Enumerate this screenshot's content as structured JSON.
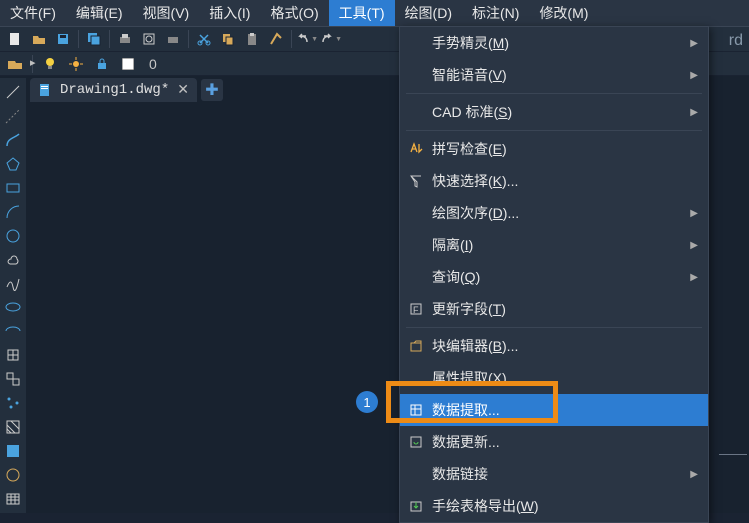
{
  "menubar": [
    {
      "label": "文件(F)"
    },
    {
      "label": "编辑(E)"
    },
    {
      "label": "视图(V)"
    },
    {
      "label": "插入(I)"
    },
    {
      "label": "格式(O)"
    },
    {
      "label": "工具(T)",
      "active": true
    },
    {
      "label": "绘图(D)"
    },
    {
      "label": "标注(N)"
    },
    {
      "label": "修改(M)"
    }
  ],
  "toolbar2": {
    "layer_value": "0"
  },
  "tab": {
    "title": "Drawing1.dwg*"
  },
  "right_fragment": "rd",
  "callout": {
    "num": "1"
  },
  "dropdown": {
    "items": [
      {
        "label": "手势精灵(",
        "hot": "M",
        "tail": ")",
        "submenu": true
      },
      {
        "label": "智能语音(",
        "hot": "V",
        "tail": ")",
        "submenu": true
      },
      {
        "sep": true
      },
      {
        "label": "CAD 标准(",
        "hot": "S",
        "tail": ")",
        "submenu": true
      },
      {
        "sep": true
      },
      {
        "label": "拼写检查(",
        "hot": "E",
        "tail": ")",
        "icon": "spell"
      },
      {
        "label": "快速选择(",
        "hot": "K",
        "tail": ")...",
        "icon": "qsel"
      },
      {
        "label": "绘图次序(",
        "hot": "D",
        "tail": ")...",
        "submenu": true
      },
      {
        "label": "隔离(",
        "hot": "I",
        "tail": ")",
        "submenu": true
      },
      {
        "label": "查询(",
        "hot": "Q",
        "tail": ")",
        "submenu": true
      },
      {
        "label": "更新字段(",
        "hot": "T",
        "tail": ")",
        "icon": "field"
      },
      {
        "sep": true
      },
      {
        "label": "块编辑器(",
        "hot": "B",
        "tail": ")...",
        "icon": "block"
      },
      {
        "label": "属性提取(",
        "hot": "X",
        "tail": ")"
      },
      {
        "label": "数据提取...",
        "hot": "",
        "tail": "",
        "icon": "data",
        "highlighted": true
      },
      {
        "label": "数据更新...",
        "hot": "",
        "tail": "",
        "icon": "refresh"
      },
      {
        "label": "数据链接",
        "hot": "",
        "tail": "",
        "submenu": true
      },
      {
        "label": "手绘表格导出(",
        "hot": "W",
        "tail": ")",
        "icon": "export"
      }
    ]
  }
}
